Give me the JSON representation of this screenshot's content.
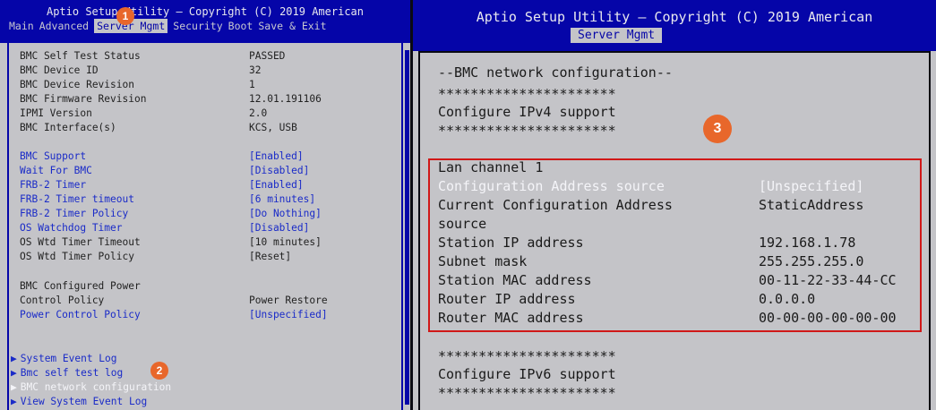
{
  "left": {
    "title": "Aptio Setup Utility – Copyright (C) 2019 American",
    "tabs": [
      "Main",
      "Advanced",
      "Server Mgmt",
      "Security",
      "Boot",
      "Save & Exit"
    ],
    "active_tab": 2,
    "info_rows": [
      {
        "label": "BMC Self Test Status",
        "value": "PASSED"
      },
      {
        "label": "BMC Device ID",
        "value": "32"
      },
      {
        "label": "BMC Device Revision",
        "value": "1"
      },
      {
        "label": "BMC Firmware Revision",
        "value": "12.01.191106"
      },
      {
        "label": "IPMI Version",
        "value": "2.0"
      },
      {
        "label": "BMC Interface(s)",
        "value": "KCS, USB"
      }
    ],
    "option_rows": [
      {
        "label": "BMC Support",
        "value": "[Enabled]"
      },
      {
        "label": "Wait For BMC",
        "value": "[Disabled]"
      },
      {
        "label": "FRB-2 Timer",
        "value": "[Enabled]"
      },
      {
        "label": "FRB-2 Timer timeout",
        "value": "[6 minutes]"
      },
      {
        "label": "FRB-2 Timer Policy",
        "value": "[Do Nothing]"
      },
      {
        "label": "OS Watchdog Timer",
        "value": "[Disabled]"
      },
      {
        "label": "OS Wtd Timer Timeout",
        "value": "[10 minutes]"
      },
      {
        "label": "OS Wtd Timer Policy",
        "value": "[Reset]"
      }
    ],
    "power_label1": "BMC Configured Power",
    "power_label2": "Control Policy",
    "power_value": "Power Restore",
    "pcp_label": "Power Control Policy",
    "pcp_value": "[Unspecified]",
    "submenus": [
      "System Event Log",
      "Bmc self test log",
      "BMC network configuration",
      "View System Event Log"
    ]
  },
  "right": {
    "title": "Aptio Setup Utility – Copyright (C) 2019 American",
    "tab": "Server Mgmt",
    "section_title": "--BMC network configuration--",
    "stars": "**********************",
    "ipv4_label": "Configure IPv4 support",
    "ipv6_label": "Configure IPv6 support",
    "lan_channel": "Lan channel 1",
    "rows": [
      {
        "label": "Configuration Address source",
        "value": "[Unspecified]"
      },
      {
        "label": "Current Configuration Address",
        "value": "StaticAddress"
      },
      {
        "label": "source",
        "value": ""
      },
      {
        "label": "Station IP address",
        "value": "192.168.1.78"
      },
      {
        "label": "Subnet mask",
        "value": "255.255.255.0"
      },
      {
        "label": "Station MAC address",
        "value": "00-11-22-33-44-CC"
      },
      {
        "label": "Router IP address",
        "value": "0.0.0.0"
      },
      {
        "label": "Router MAC address",
        "value": "00-00-00-00-00-00"
      }
    ]
  },
  "badges": [
    "1",
    "2",
    "3"
  ],
  "colors": {
    "header": "#0505a8",
    "panel": "#c4c4c8",
    "option_text": "#1a2bc8",
    "highlight_box": "#d01818",
    "badge": "#e8672b"
  }
}
